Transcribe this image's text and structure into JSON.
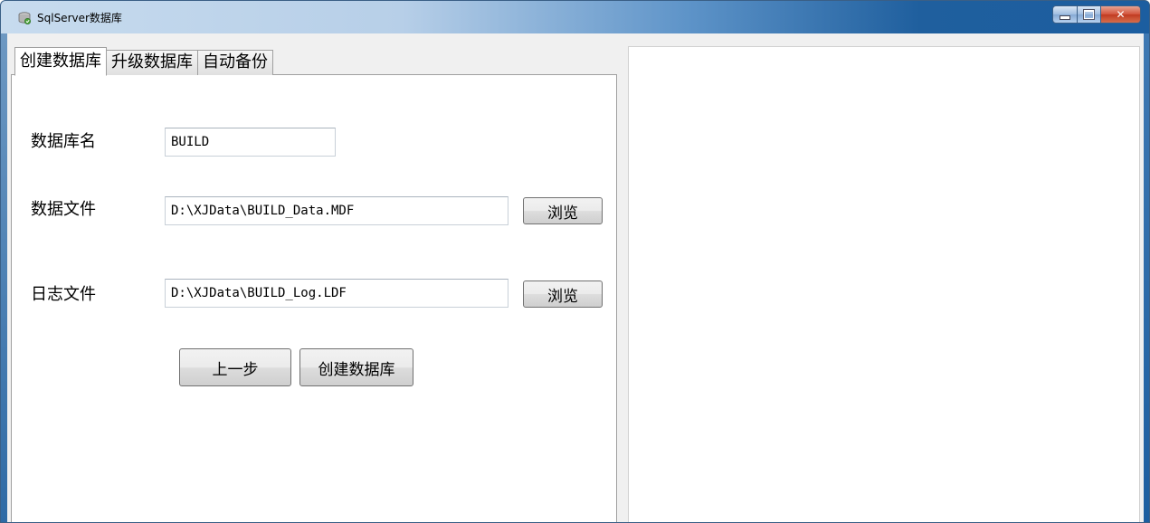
{
  "window": {
    "title": "SqlServer数据库"
  },
  "tabs": [
    {
      "label": "创建数据库",
      "active": true
    },
    {
      "label": "升级数据库",
      "active": false
    },
    {
      "label": "自动备份",
      "active": false
    }
  ],
  "form": {
    "db_name_label": "数据库名",
    "db_name_value": "BUILD",
    "data_file_label": "数据文件",
    "data_file_value": "D:\\XJData\\BUILD_Data.MDF",
    "data_browse_label": "浏览",
    "log_file_label": "日志文件",
    "log_file_value": "D:\\XJData\\BUILD_Log.LDF",
    "log_browse_label": "浏览",
    "prev_label": "上一步",
    "create_label": "创建数据库"
  },
  "icons": {
    "app": "database-app-icon",
    "minimize": "minimize-icon",
    "maximize": "maximize-icon",
    "close": "close-icon"
  },
  "colors": {
    "close_button": "#c13b21",
    "title_gradient_end": "#1c5ea0",
    "client_bg": "#f0f0f0"
  }
}
